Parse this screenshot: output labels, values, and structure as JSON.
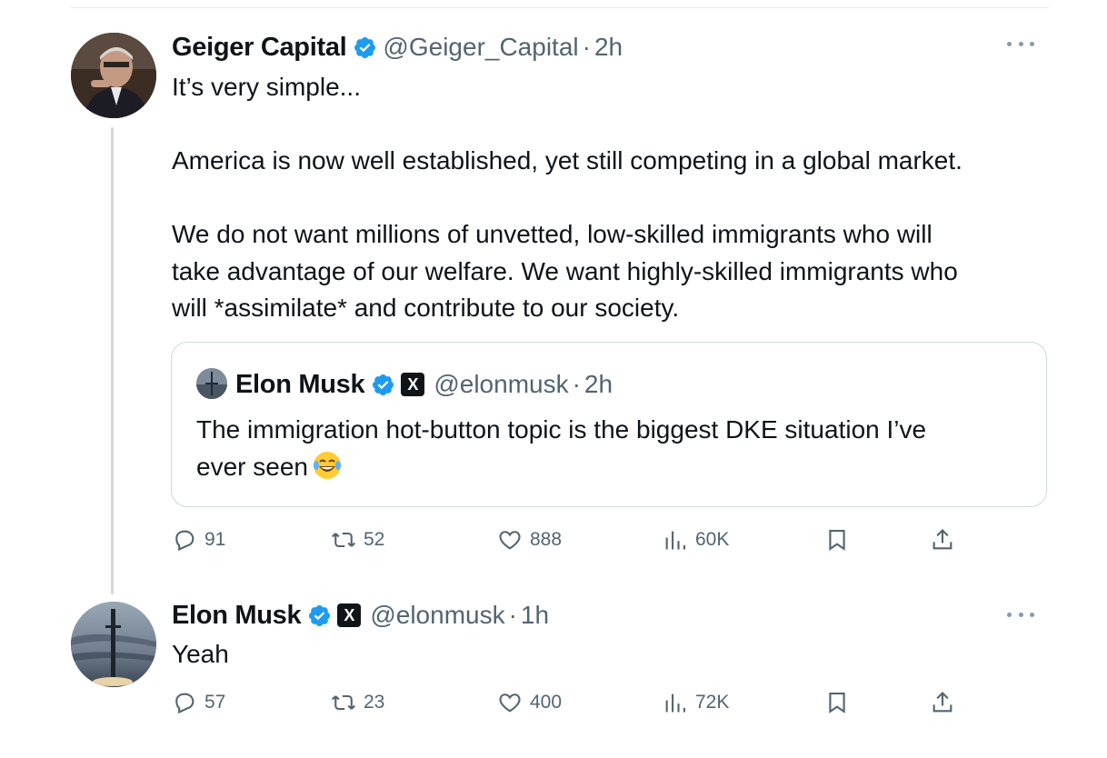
{
  "tweets": [
    {
      "author_name": "Geiger Capital",
      "handle": "@Geiger_Capital",
      "time": "2h",
      "lines": [
        "It’s very simple...",
        "",
        "America is now well established, yet still competing in a global market.",
        "",
        "We do not want millions of unvetted, low-skilled immigrants who will",
        "take advantage of our welfare. We want highly-skilled immigrants who",
        "will *assimilate* and contribute to our society."
      ],
      "stats": {
        "replies": "91",
        "reposts": "52",
        "likes": "888",
        "views": "60K"
      }
    },
    {
      "author_name": "Elon Musk",
      "handle": "@elonmusk",
      "time": "1h",
      "text": "Yeah",
      "stats": {
        "replies": "57",
        "reposts": "23",
        "likes": "400",
        "views": "72K"
      }
    }
  ],
  "quote": {
    "author_name": "Elon Musk",
    "handle": "@elonmusk",
    "time": "2h",
    "line1": "The immigration hot-button topic is the biggest DKE situation I’ve",
    "line2": "ever seen"
  },
  "separator": "·",
  "badge_text": "X",
  "icons": {
    "verified": "verified-badge-icon",
    "reply": "reply-icon",
    "repost": "repost-icon",
    "like": "heart-icon",
    "views": "views-icon",
    "bookmark": "bookmark-icon",
    "share": "share-icon",
    "more": "more-icon",
    "emoji": "laughing-tears-emoji"
  },
  "colors": {
    "verified": "#1d9bf0",
    "secondary_text": "#536471",
    "thread_line": "#cfd9de"
  }
}
